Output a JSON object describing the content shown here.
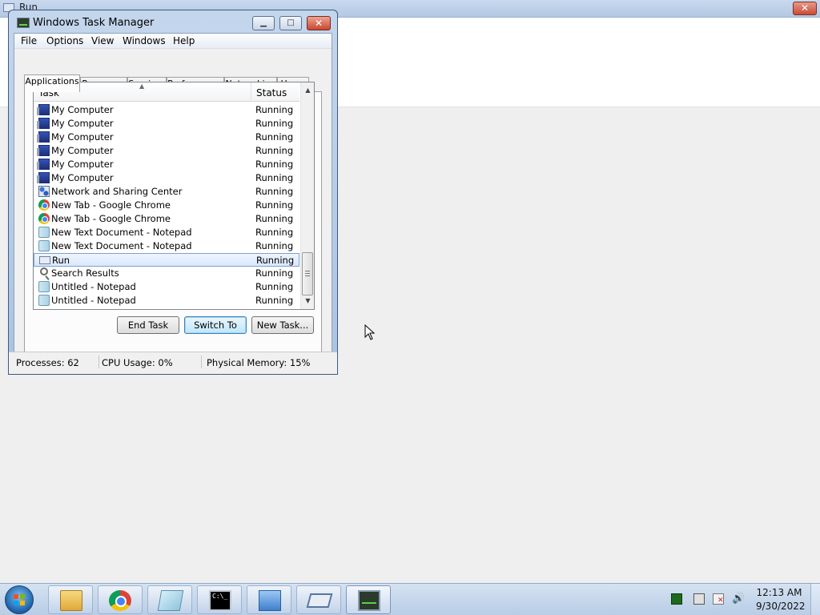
{
  "background_window": {
    "title": "Run",
    "close_label": "✕"
  },
  "task_manager": {
    "title": "Windows Task Manager",
    "window_buttons": {
      "minimize": "▁",
      "maximize": "□",
      "close": "✕"
    },
    "menu": [
      "File",
      "Options",
      "View",
      "Windows",
      "Help"
    ],
    "tabs": [
      {
        "label": "Applications",
        "active": true
      },
      {
        "label": "Processes",
        "active": false
      },
      {
        "label": "Services",
        "active": false
      },
      {
        "label": "Performance",
        "active": false
      },
      {
        "label": "Networking",
        "active": false
      },
      {
        "label": "Users",
        "active": false
      }
    ],
    "list": {
      "columns": [
        "Task",
        "Status"
      ],
      "sort_indicator": "▲",
      "rows": [
        {
          "task": "My Computer",
          "status": "Running",
          "icon": "computer-icon"
        },
        {
          "task": "My Computer",
          "status": "Running",
          "icon": "computer-icon"
        },
        {
          "task": "My Computer",
          "status": "Running",
          "icon": "computer-icon"
        },
        {
          "task": "My Computer",
          "status": "Running",
          "icon": "computer-icon"
        },
        {
          "task": "My Computer",
          "status": "Running",
          "icon": "computer-icon"
        },
        {
          "task": "My Computer",
          "status": "Running",
          "icon": "computer-icon"
        },
        {
          "task": "Network and Sharing Center",
          "status": "Running",
          "icon": "network-icon"
        },
        {
          "task": "New Tab - Google Chrome",
          "status": "Running",
          "icon": "chrome-icon"
        },
        {
          "task": "New Tab - Google Chrome",
          "status": "Running",
          "icon": "chrome-icon"
        },
        {
          "task": "New Text Document - Notepad",
          "status": "Running",
          "icon": "notepad-icon"
        },
        {
          "task": "New Text Document - Notepad",
          "status": "Running",
          "icon": "notepad-icon"
        },
        {
          "task": "Run",
          "status": "Running",
          "icon": "run-icon",
          "selected": true
        },
        {
          "task": "Search Results",
          "status": "Running",
          "icon": "search-icon"
        },
        {
          "task": "Untitled - Notepad",
          "status": "Running",
          "icon": "notepad-icon"
        },
        {
          "task": "Untitled - Notepad",
          "status": "Running",
          "icon": "notepad-icon"
        }
      ]
    },
    "buttons": {
      "end_task": "End Task",
      "switch_to": "Switch To",
      "new_task": "New Task..."
    },
    "status_bar": {
      "processes": "Processes: 62",
      "cpu": "CPU Usage: 0%",
      "memory": "Physical Memory: 15%"
    }
  },
  "taskbar": {
    "pinned": [
      {
        "name": "windows-explorer"
      },
      {
        "name": "google-chrome"
      },
      {
        "name": "notepad"
      },
      {
        "name": "command-prompt"
      },
      {
        "name": "control-panel"
      },
      {
        "name": "run"
      },
      {
        "name": "task-manager",
        "active": true
      }
    ],
    "clock": {
      "time": "12:13 AM",
      "date": "9/30/2022"
    }
  },
  "colors": {
    "selection": "#d9e8fb",
    "titlebar": "#b4c8e4",
    "taskbar": "#b9cde6"
  }
}
